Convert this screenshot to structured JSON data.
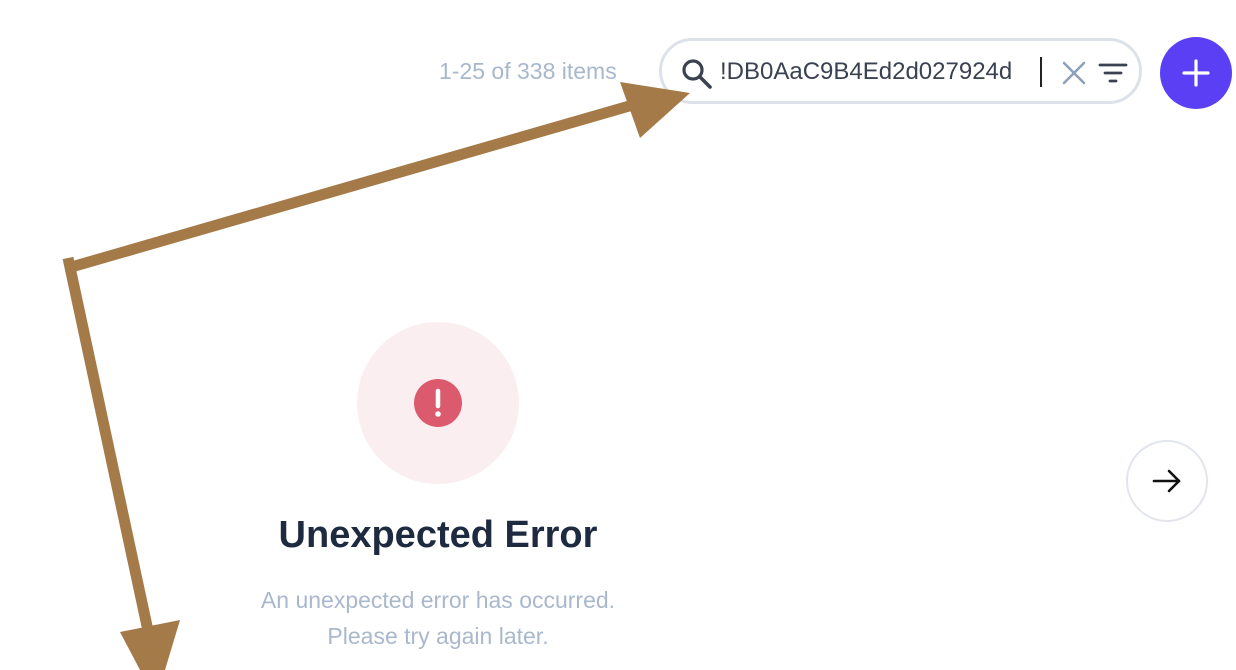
{
  "toolbar": {
    "item_count": "1-25 of 338 items",
    "search_value": "!DB0AaC9B4Ed2d027924d",
    "add_label": "+"
  },
  "error": {
    "title": "Unexpected Error",
    "message_line1": "An unexpected error has occurred.",
    "message_line2": "Please try again later."
  },
  "icons": {
    "search": "search-icon",
    "clear": "close-icon",
    "filter": "filter-icon",
    "add": "plus-icon",
    "error": "exclamation-icon",
    "next": "arrow-right-icon"
  },
  "colors": {
    "accent": "#5b3ff5",
    "error": "#dc5a6e",
    "error_bg": "#fbeef0",
    "annotation": "#a47b48",
    "muted_text": "#a9b8cc",
    "title_text": "#1e2a40"
  }
}
